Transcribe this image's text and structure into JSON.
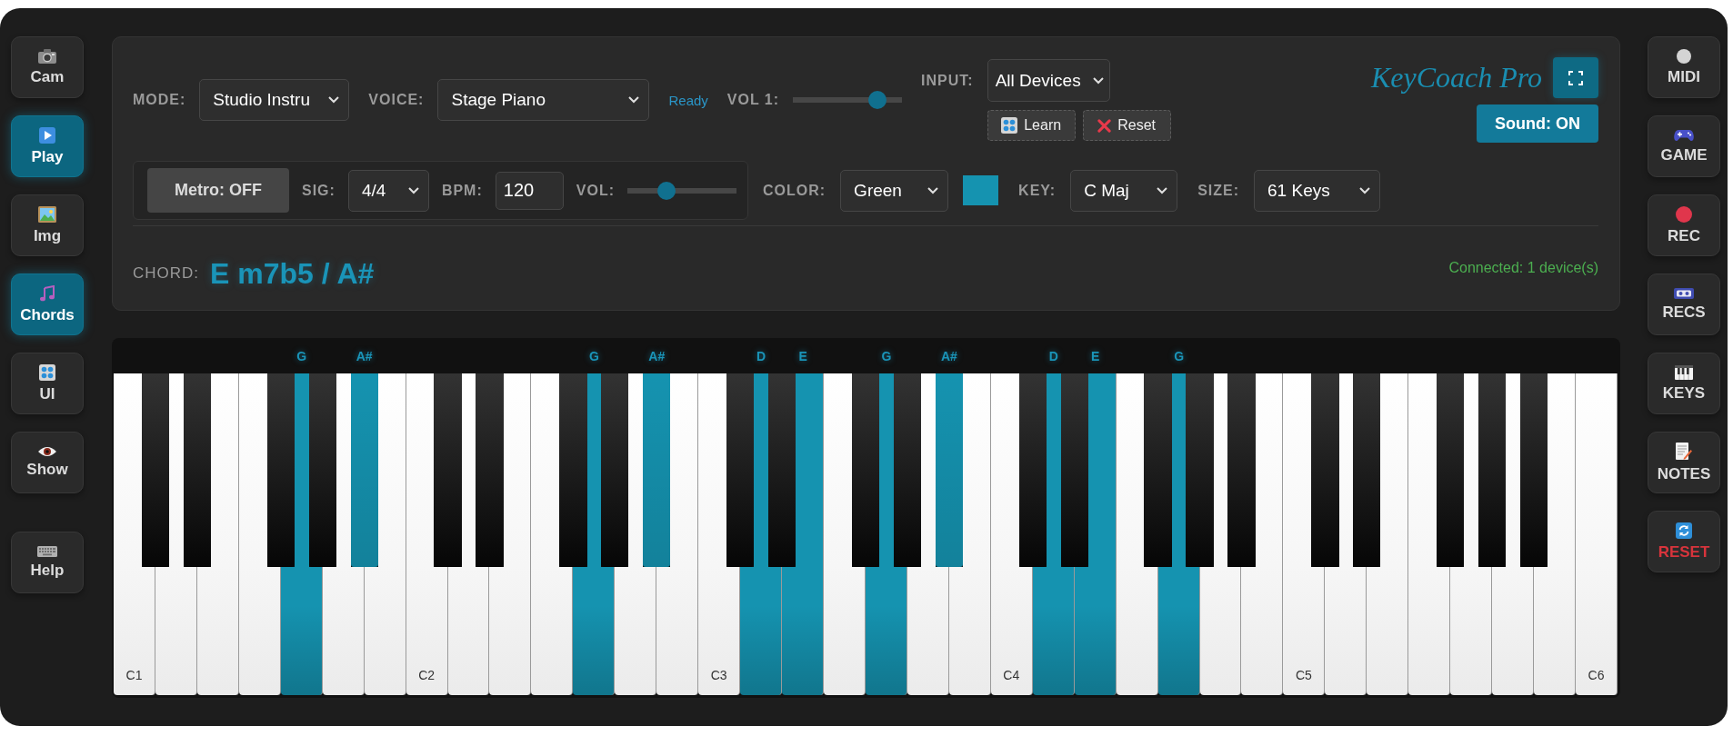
{
  "left_sidebar": {
    "items": [
      {
        "label": "Cam",
        "selected": false
      },
      {
        "label": "Play",
        "selected": true
      },
      {
        "label": "Img",
        "selected": false
      },
      {
        "label": "Chords",
        "selected": true
      },
      {
        "label": "UI",
        "selected": false
      },
      {
        "label": "Show",
        "selected": false
      }
    ],
    "footer_items": [
      {
        "label": "Help",
        "selected": false
      }
    ]
  },
  "toolbar": {
    "mode": {
      "label": "MODE:",
      "value": "Studio Instru"
    },
    "voice": {
      "label": "VOICE:",
      "value": "Stage Piano"
    },
    "status": "Ready",
    "volume": {
      "label": "VOL 1:",
      "level": 0.83
    },
    "input": {
      "label": "INPUT:",
      "value": "All Devices",
      "buttons": [
        "Learn",
        "Reset"
      ]
    },
    "logo": "KeyCoach Pro",
    "sound_button": {
      "label": "Sound: ON",
      "on": true
    }
  },
  "settings": {
    "metronome": {
      "button": {
        "label": "Metro: OFF",
        "on": false
      },
      "signature": {
        "label": "SIG:",
        "value": "4/4"
      },
      "bpm": {
        "label": "BPM:",
        "value": "120"
      },
      "volume": {
        "label": "VOL:",
        "level": 0.33
      }
    },
    "color": {
      "label": "COLOR:",
      "value": "Green",
      "swatch": {
        "color": "#1593b0"
      }
    },
    "key": {
      "label": "KEY:",
      "value": "C Maj"
    },
    "size": {
      "label": "SIZE:",
      "value": "61 Keys"
    }
  },
  "chord": {
    "label": "CHORD:",
    "name": "E m7b5 / A#",
    "connection": "Connected: 1 device(s)"
  },
  "keyboard": {
    "keys": [
      {
        "kind": "natural",
        "active": false,
        "label": "C1"
      },
      {
        "kind": "sharp",
        "active": false
      },
      {
        "kind": "natural",
        "active": false
      },
      {
        "kind": "sharp",
        "active": false
      },
      {
        "kind": "natural",
        "active": false
      },
      {
        "kind": "natural",
        "active": false
      },
      {
        "kind": "sharp",
        "active": false
      },
      {
        "kind": "natural",
        "active": true,
        "note": "G"
      },
      {
        "kind": "sharp",
        "active": false
      },
      {
        "kind": "natural",
        "active": false
      },
      {
        "kind": "sharp",
        "active": true,
        "note": "A#"
      },
      {
        "kind": "natural",
        "active": false
      },
      {
        "kind": "natural",
        "active": false,
        "label": "C2"
      },
      {
        "kind": "sharp",
        "active": false
      },
      {
        "kind": "natural",
        "active": false
      },
      {
        "kind": "sharp",
        "active": false
      },
      {
        "kind": "natural",
        "active": false
      },
      {
        "kind": "natural",
        "active": false
      },
      {
        "kind": "sharp",
        "active": false
      },
      {
        "kind": "natural",
        "active": true,
        "note": "G"
      },
      {
        "kind": "sharp",
        "active": false
      },
      {
        "kind": "natural",
        "active": false
      },
      {
        "kind": "sharp",
        "active": true,
        "note": "A#"
      },
      {
        "kind": "natural",
        "active": false
      },
      {
        "kind": "natural",
        "active": false,
        "label": "C3"
      },
      {
        "kind": "sharp",
        "active": false
      },
      {
        "kind": "natural",
        "active": true,
        "note": "D"
      },
      {
        "kind": "sharp",
        "active": false
      },
      {
        "kind": "natural",
        "active": true,
        "note": "E"
      },
      {
        "kind": "natural",
        "active": false
      },
      {
        "kind": "sharp",
        "active": false
      },
      {
        "kind": "natural",
        "active": true,
        "note": "G"
      },
      {
        "kind": "sharp",
        "active": false
      },
      {
        "kind": "natural",
        "active": false
      },
      {
        "kind": "sharp",
        "active": true,
        "note": "A#"
      },
      {
        "kind": "natural",
        "active": false
      },
      {
        "kind": "natural",
        "active": false,
        "label": "C4"
      },
      {
        "kind": "sharp",
        "active": false
      },
      {
        "kind": "natural",
        "active": true,
        "note": "D"
      },
      {
        "kind": "sharp",
        "active": false
      },
      {
        "kind": "natural",
        "active": true,
        "note": "E"
      },
      {
        "kind": "natural",
        "active": false
      },
      {
        "kind": "sharp",
        "active": false
      },
      {
        "kind": "natural",
        "active": true,
        "note": "G"
      },
      {
        "kind": "sharp",
        "active": false
      },
      {
        "kind": "natural",
        "active": false
      },
      {
        "kind": "sharp",
        "active": false
      },
      {
        "kind": "natural",
        "active": false
      },
      {
        "kind": "natural",
        "active": false,
        "label": "C5"
      },
      {
        "kind": "sharp",
        "active": false
      },
      {
        "kind": "natural",
        "active": false
      },
      {
        "kind": "sharp",
        "active": false
      },
      {
        "kind": "natural",
        "active": false
      },
      {
        "kind": "natural",
        "active": false
      },
      {
        "kind": "sharp",
        "active": false
      },
      {
        "kind": "natural",
        "active": false
      },
      {
        "kind": "sharp",
        "active": false
      },
      {
        "kind": "natural",
        "active": false
      },
      {
        "kind": "sharp",
        "active": false
      },
      {
        "kind": "natural",
        "active": false
      },
      {
        "kind": "natural",
        "active": false,
        "label": "C6"
      }
    ]
  },
  "right_sidebar": {
    "items": [
      {
        "label": "MIDI",
        "kind": "normal"
      },
      {
        "label": "GAME",
        "kind": "normal"
      },
      {
        "label": "REC",
        "kind": "normal"
      },
      {
        "label": "RECS",
        "kind": "normal"
      },
      {
        "label": "KEYS",
        "kind": "normal"
      },
      {
        "label": "NOTES",
        "kind": "normal"
      },
      {
        "label": "RESET",
        "kind": "danger"
      }
    ]
  }
}
